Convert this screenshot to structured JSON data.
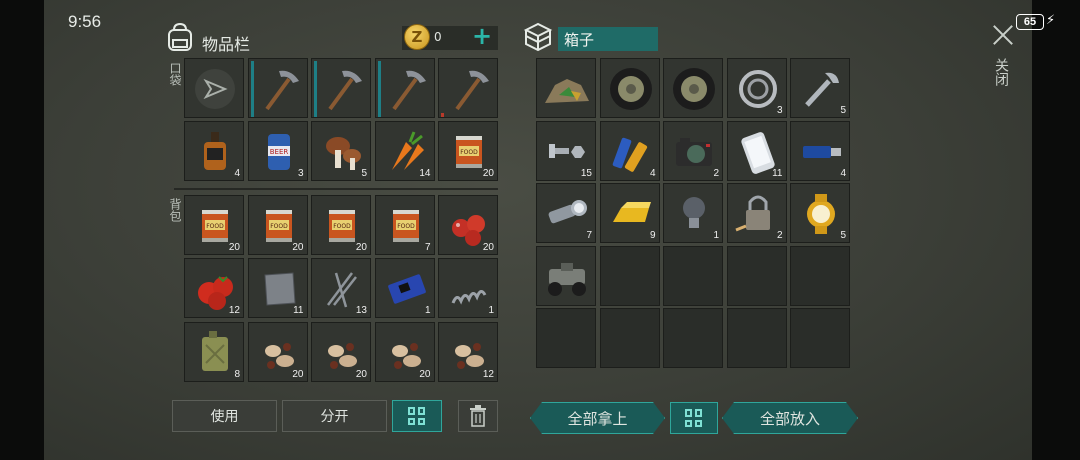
{
  "status": {
    "time": "9:56",
    "battery": "65"
  },
  "inventory": {
    "title": "物品栏",
    "coins": "0",
    "pocket_label": "口袋",
    "backpack_label": "背包"
  },
  "box": {
    "title": "箱子"
  },
  "close_label": "关闭",
  "left_rows": [
    [
      {
        "icon": "gun-equip-slot-icon",
        "qty": ""
      },
      {
        "icon": "pickaxe-icon",
        "qty": "",
        "bar": "teal"
      },
      {
        "icon": "pickaxe-icon",
        "qty": "",
        "bar": "teal"
      },
      {
        "icon": "pickaxe-icon",
        "qty": "",
        "bar": "teal"
      },
      {
        "icon": "pickaxe-icon",
        "qty": "",
        "bar": "red"
      }
    ],
    [
      {
        "icon": "whiskey-bottle-icon",
        "qty": "4"
      },
      {
        "icon": "beer-can-icon",
        "qty": "3"
      },
      {
        "icon": "mushroom-icon",
        "qty": "5"
      },
      {
        "icon": "carrot-icon",
        "qty": "14"
      },
      {
        "icon": "canned-food-icon",
        "qty": "20"
      }
    ],
    [
      {
        "icon": "canned-food-icon",
        "qty": "20"
      },
      {
        "icon": "canned-food-icon",
        "qty": "20"
      },
      {
        "icon": "canned-food-icon",
        "qty": "20"
      },
      {
        "icon": "canned-food-icon",
        "qty": "7"
      },
      {
        "icon": "berries-icon",
        "qty": "20"
      }
    ],
    [
      {
        "icon": "tomato-icon",
        "qty": "12"
      },
      {
        "icon": "metal-plate-icon",
        "qty": "11"
      },
      {
        "icon": "nails-icon",
        "qty": "13"
      },
      {
        "icon": "circuit-board-icon",
        "qty": "1"
      },
      {
        "icon": "spring-icon",
        "qty": "1"
      }
    ],
    [
      {
        "icon": "jerry-can-icon",
        "qty": "8"
      },
      {
        "icon": "seeds-icon",
        "qty": "20"
      },
      {
        "icon": "seeds-icon",
        "qty": "20"
      },
      {
        "icon": "seeds-icon",
        "qty": "20"
      },
      {
        "icon": "seeds-icon",
        "qty": "12"
      }
    ]
  ],
  "right_rows": [
    [
      {
        "icon": "ore-pile-icon",
        "qty": ""
      },
      {
        "icon": "wheel-icon",
        "qty": ""
      },
      {
        "icon": "wheel-icon",
        "qty": ""
      },
      {
        "icon": "bearing-icon",
        "qty": "3"
      },
      {
        "icon": "wrench-icon",
        "qty": "5"
      }
    ],
    [
      {
        "icon": "bolt-nut-icon",
        "qty": "15"
      },
      {
        "icon": "battery-icon",
        "qty": "4"
      },
      {
        "icon": "camera-icon",
        "qty": "2"
      },
      {
        "icon": "smartphone-icon",
        "qty": "11"
      },
      {
        "icon": "usb-drive-icon",
        "qty": "4"
      }
    ],
    [
      {
        "icon": "flashlight-icon",
        "qty": "7"
      },
      {
        "icon": "gold-bar-icon",
        "qty": "9"
      },
      {
        "icon": "light-bulb-icon",
        "qty": "1"
      },
      {
        "icon": "padlock-icon",
        "qty": "2"
      },
      {
        "icon": "gold-watch-icon",
        "qty": "5"
      }
    ],
    [
      {
        "icon": "atv-icon",
        "qty": ""
      },
      {
        "icon": "",
        "qty": ""
      },
      {
        "icon": "",
        "qty": ""
      },
      {
        "icon": "",
        "qty": ""
      },
      {
        "icon": "",
        "qty": ""
      }
    ],
    [
      {
        "icon": "",
        "qty": ""
      },
      {
        "icon": "",
        "qty": ""
      },
      {
        "icon": "",
        "qty": ""
      },
      {
        "icon": "",
        "qty": ""
      },
      {
        "icon": "",
        "qty": ""
      }
    ]
  ],
  "buttons": {
    "use": "使用",
    "split": "分开",
    "take_all": "全部拿上",
    "put_all": "全部放入"
  },
  "colors": {
    "accent": "#2fa69b",
    "box_title_bg": "#1f6b67"
  }
}
